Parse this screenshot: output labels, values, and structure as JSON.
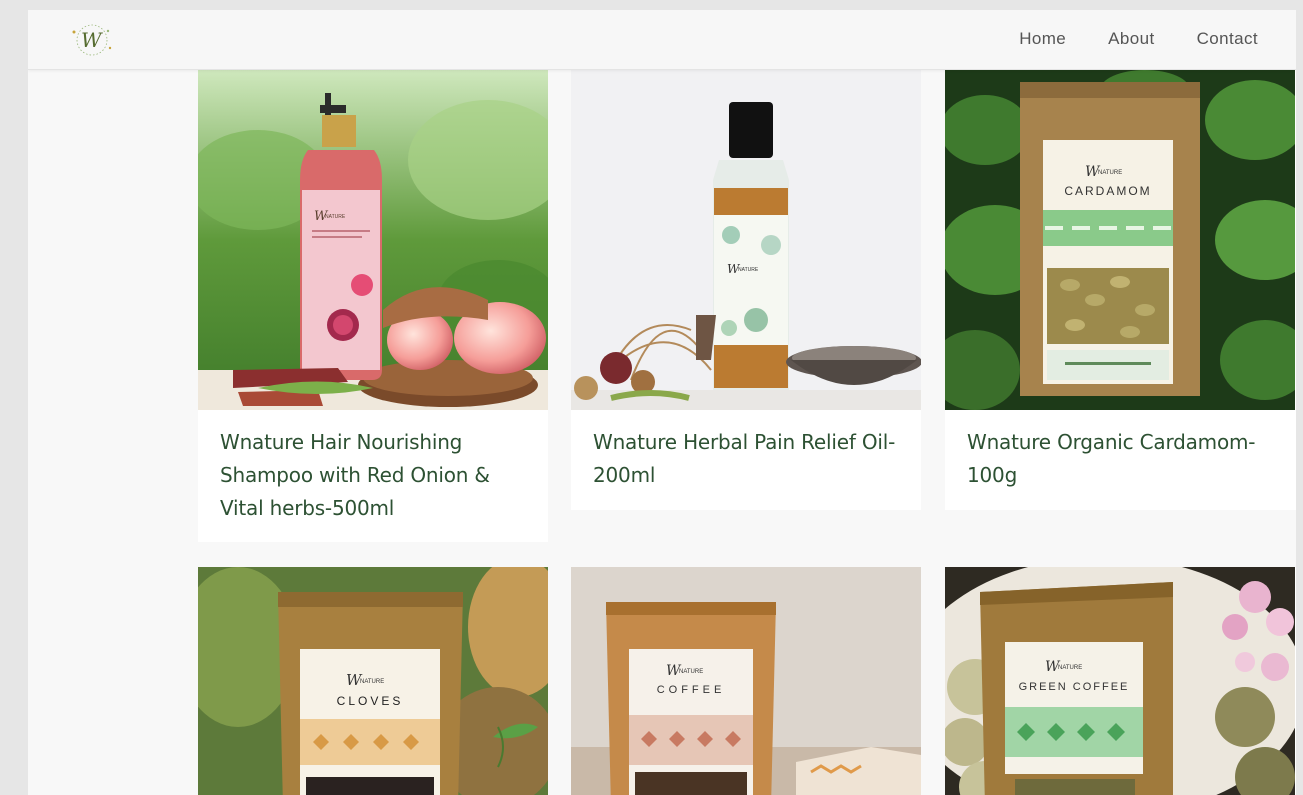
{
  "header": {
    "logo_alt": "Wnature",
    "nav": [
      "Home",
      "About",
      "Contact"
    ]
  },
  "products": [
    {
      "title": "Wnature Hair Nourishing Shampoo with Red Onion & Vital herbs-500ml",
      "label_text": "WNATURE"
    },
    {
      "title": "Wnature Herbal Pain Relief Oil-200ml",
      "label_text": "WNATURE"
    },
    {
      "title": "Wnature Organic Cardamom-100g",
      "label_text": "CARDAMOM"
    },
    {
      "title": "",
      "label_text": "CLOVES"
    },
    {
      "title": "",
      "label_text": "COFFEE"
    },
    {
      "title": "",
      "label_text": "GREEN COFFEE"
    }
  ],
  "colors": {
    "title_green": "#2d5133",
    "nav_text": "#555555",
    "kraft": "#b08a4e",
    "leaf_green": "#2e5a2a"
  }
}
